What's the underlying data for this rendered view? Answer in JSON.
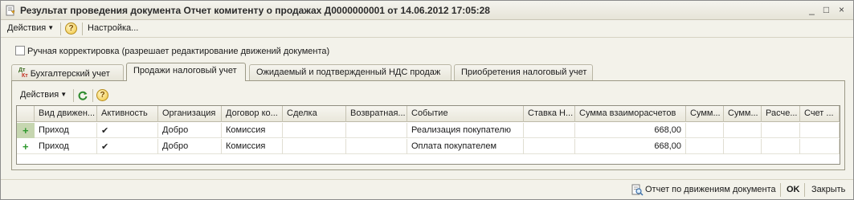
{
  "window": {
    "title": "Результат проведения документа Отчет комитенту о продажах Д0000000001 от 14.06.2012 17:05:28",
    "controls": {
      "minimize": "_",
      "maximize": "□",
      "close": "×"
    }
  },
  "toolbar": {
    "actions_label": "Действия",
    "help_label": "?",
    "settings_label": "Настройка..."
  },
  "manual_adjustment": {
    "label": "Ручная корректировка (разрешает редактирование движений документа)",
    "checked": false
  },
  "tabs": [
    {
      "label": "Бухгалтерский учет",
      "icon": "dt-kt-icon",
      "icon_top": "Дт",
      "icon_bottom": "Кт",
      "active": false
    },
    {
      "label": "Продажи налоговый учет",
      "active": true
    },
    {
      "label": "Ожидаемый и подтвержденный НДС продаж",
      "active": false
    },
    {
      "label": "Приобретения налоговый учет",
      "active": false
    }
  ],
  "inner_toolbar": {
    "actions_label": "Действия",
    "refresh_icon": "refresh-icon",
    "help_label": "?"
  },
  "grid": {
    "columns": [
      "Вид движен...",
      "Активность",
      "Организация",
      "Договор ко...",
      "Сделка",
      "Возвратная...",
      "Событие",
      "Ставка Н...",
      "Сумма взаиморасчетов",
      "Сумм...",
      "Сумм...",
      "Расче...",
      "Счет ..."
    ],
    "rows": [
      {
        "kind": "Приход",
        "active": "✔",
        "org": "Добро",
        "contract": "Комиссия",
        "deal": "",
        "returnable": "",
        "event": "Реализация покупателю",
        "vat_rate": "",
        "amount": "668,00",
        "c10": "",
        "c11": "",
        "c12": "",
        "c13": "",
        "selected": true
      },
      {
        "kind": "Приход",
        "active": "✔",
        "org": "Добро",
        "contract": "Комиссия",
        "deal": "",
        "returnable": "",
        "event": "Оплата покупателем",
        "vat_rate": "",
        "amount": "668,00",
        "c10": "",
        "c11": "",
        "c12": "",
        "c13": "",
        "selected": false
      }
    ]
  },
  "bottom_bar": {
    "report_label": "Отчет по движениям документа",
    "ok_label": "OK",
    "close_label": "Закрыть"
  },
  "colors": {
    "window_bg": "#f3f2ea",
    "selected_row_marker": "#c6d6b0",
    "plus_green": "#2f9a2f"
  }
}
